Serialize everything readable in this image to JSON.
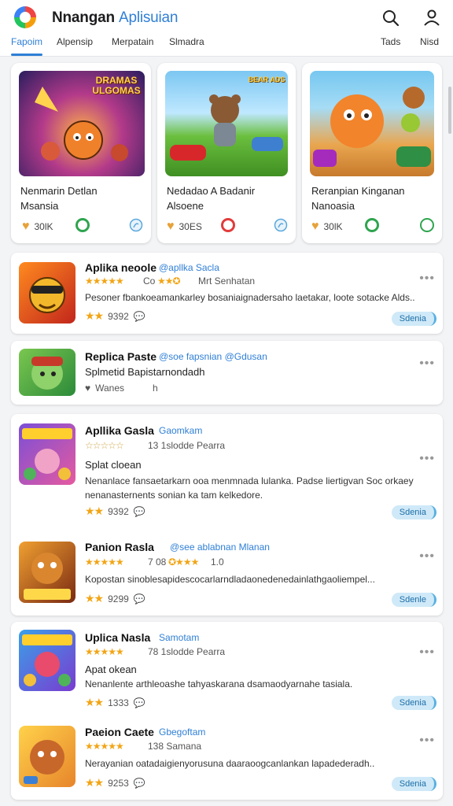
{
  "header": {
    "title_main": "Nnangan",
    "title_accent": "Aplisuian",
    "right_labels": [
      "Tads",
      "Nisd"
    ],
    "tabs": [
      "Fapoim",
      "Alpensip",
      "Merpatain",
      "Slmadra"
    ]
  },
  "featured": [
    {
      "art_text": "DRAMAS ULGOMAS",
      "title": "Nenmarin Detlan Msansia",
      "count": "30lK"
    },
    {
      "art_text": "BEAR ADS",
      "title": "Nedadao A Badanir Alsoene",
      "count": "30ES"
    },
    {
      "art_text": "",
      "title": "Reranpian Kinganan Nanoasia",
      "count": "30lK"
    }
  ],
  "apps": [
    {
      "name": "Aplika neoole",
      "dev": "@apllka Sacla",
      "rating_text": "Co",
      "meta": "Mrt Senhatan",
      "desc": "Pesoner fbankoeamankarley bosaniaignadersaho laetakar, loote sotacke Alds..",
      "score": "9392",
      "button": "Sdenia"
    },
    {
      "name": "Replica Paste",
      "dev": "@soe fapsnian @Gdusan",
      "sub": "Splmetid Bapistarnondadh",
      "likes": "Wanes",
      "likes_suffix": "h"
    },
    {
      "name": "Apllika Gasla",
      "dev": "Gaomkam",
      "meta": "13 1slodde Pearra",
      "sub": "Splat cloean",
      "desc": "Nenanlace fansaetarkarn ooa menmnada lulanka. Padse liertigvan Soc orkaey nenanasternents sonian ka tam kelkedore.",
      "score": "9392",
      "button": "Sdenia"
    },
    {
      "name": "Panion Rasla",
      "dev": "@see ablabnan Mlanan",
      "meta": "7 08",
      "meta2": "1.0",
      "desc": "Kopostan sinoblesapidescocarlarndladaonedenedainlathgaoliempel...",
      "score": "9299",
      "button": "Sdenle"
    },
    {
      "name": "Uplica Nasla",
      "dev": "Samotam",
      "meta": "78 1slodde Pearra",
      "sub": "Apat okean",
      "desc": "Nenanlente arthleoashe tahyaskarana dsamaodyarnahe tasiala.",
      "score": "1333",
      "button": "Sdenia"
    },
    {
      "name": "Paeion Caete",
      "dev": "Gbegoftam",
      "meta": "138 Samana",
      "desc": "Nerayanian oatadaigienyorusuna daaraoogcanlankan lapadederadh..",
      "score": "9253",
      "button": "Sdenia"
    }
  ],
  "colors": {
    "accent": "#2f7fd6",
    "star": "#f2a516",
    "pill_bg": "#cfe9f8"
  }
}
